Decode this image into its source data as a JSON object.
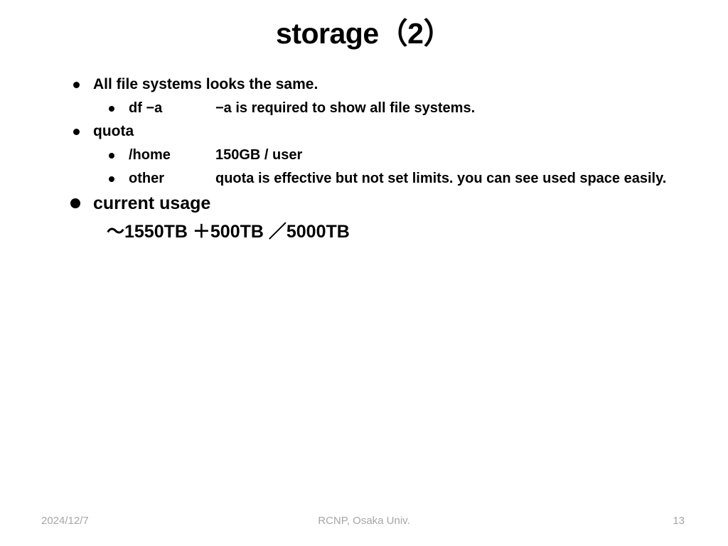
{
  "slide": {
    "title": "storage（2）",
    "background_color": "#ffffff",
    "text_color": "#000000"
  },
  "bullets": [
    {
      "level": 1,
      "label": "All file systems looks the same.",
      "detail": ""
    },
    {
      "level": 2,
      "label": "df −a",
      "detail": "−a is required to show all file systems."
    },
    {
      "level": 1,
      "label": "quota",
      "detail": ""
    },
    {
      "level": 2,
      "label": "/home",
      "detail": "150GB / user"
    },
    {
      "level": 2,
      "label": "other",
      "detail": "quota is effective but not set limits. you can see used space easily."
    },
    {
      "level": 1,
      "label": "current usage",
      "detail": "",
      "emphasis": true
    }
  ],
  "usage_line": {
    "text": "～1550TB ＋500TB ／5000TB",
    "used_tb": 1550,
    "added_tb": 500,
    "total_tb": 5000
  },
  "footer": {
    "date": "2024/12/7",
    "organization": "RCNP, Osaka Univ.",
    "page_number": "13",
    "color": "#a6a6a6"
  }
}
